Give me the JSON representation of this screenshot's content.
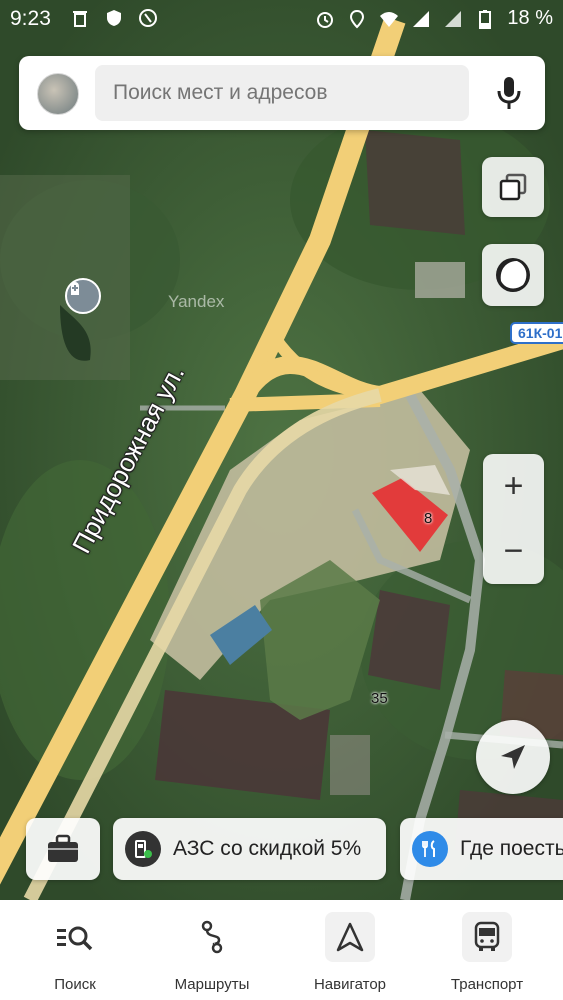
{
  "status_bar": {
    "time": "9:23",
    "battery": "18 %",
    "icons": [
      "trash-icon",
      "shield-icon",
      "phone-icon",
      "alarm-icon",
      "location-icon",
      "wifi-icon",
      "signal-icon",
      "signal-icon",
      "battery-icon"
    ]
  },
  "search": {
    "placeholder": "Поиск мест и адресов",
    "value": ""
  },
  "map": {
    "street_label": "Придорожная ул.",
    "road_badge": "61К-01:",
    "watermark": "Yandex",
    "house_numbers": [
      "8",
      "35"
    ],
    "controls": {
      "zoom_in": "+",
      "zoom_out": "−"
    }
  },
  "chips": [
    {
      "label": "АЗС со скидкой 5%",
      "icon": "gas-station-icon",
      "color": "#333333"
    },
    {
      "label": "Где поесть",
      "icon": "fork-knife-icon",
      "color": "#2f8be8"
    }
  ],
  "tabs": [
    {
      "label": "Поиск",
      "icon": "search-list-icon"
    },
    {
      "label": "Маршруты",
      "icon": "route-icon"
    },
    {
      "label": "Навигатор",
      "icon": "navigator-arrow-icon"
    },
    {
      "label": "Транспорт",
      "icon": "bus-icon"
    }
  ],
  "colors": {
    "road": "#f4d27a",
    "building_roof": "#e23b3b",
    "accent_blue": "#2e6fc9"
  }
}
